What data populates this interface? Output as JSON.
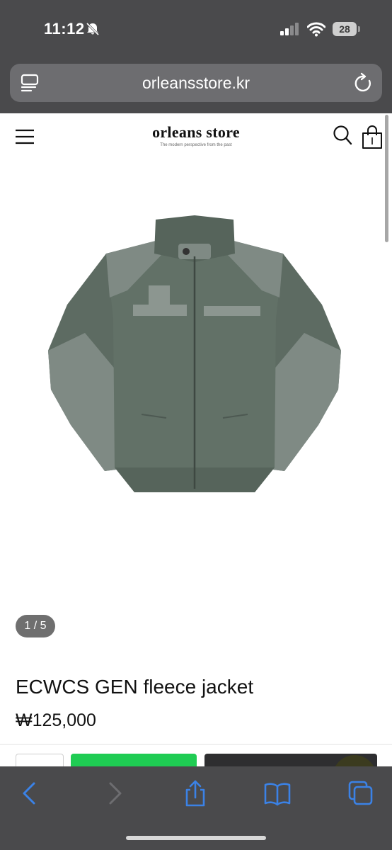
{
  "status_bar": {
    "time": "11:12",
    "battery": "28",
    "icons": [
      "bell-slash-icon",
      "cellular-signal-icon",
      "wifi-icon",
      "battery-icon"
    ]
  },
  "browser": {
    "url": "orleansstore.kr",
    "icons": [
      "reader-icon",
      "reload-icon"
    ]
  },
  "site": {
    "logo_title": "orleans store",
    "logo_tagline": "The modern perspective from the past",
    "icons": [
      "menu-icon",
      "search-icon",
      "shopping-bag-icon"
    ]
  },
  "product": {
    "image_counter": "1 / 5",
    "title": "ECWCS GEN fleece jacket",
    "price": "₩125,000",
    "image_subject": "jacket-photo"
  },
  "toolbar": {
    "icons": [
      "back-icon",
      "forward-icon",
      "share-icon",
      "bookmarks-icon",
      "tabs-icon"
    ]
  },
  "colors": {
    "browser_chrome": "#4a4a4c",
    "url_bar": "#6d6d70",
    "buy_button": "#1fcc53",
    "cart_button": "#2e2e30",
    "toolbar_accent": "#3b82e6",
    "jacket_fleece": "#5d6b62",
    "jacket_nylon": "#7f8a84"
  }
}
